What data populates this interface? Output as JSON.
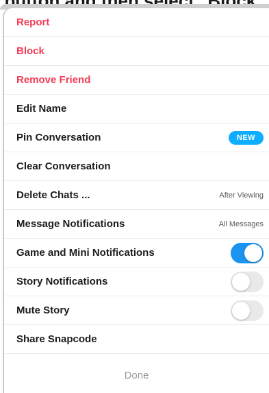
{
  "top_caption": "button and then select \"Block\"",
  "menu": {
    "items": [
      {
        "label": "Report",
        "style": "danger",
        "trailing": "none"
      },
      {
        "label": "Block",
        "style": "danger",
        "trailing": "none"
      },
      {
        "label": "Remove Friend",
        "style": "danger",
        "trailing": "none"
      },
      {
        "label": "Edit Name",
        "style": "normal",
        "trailing": "none"
      },
      {
        "label": "Pin Conversation",
        "style": "normal",
        "trailing": "badge",
        "badge": "NEW"
      },
      {
        "label": "Clear Conversation",
        "style": "normal",
        "trailing": "none"
      },
      {
        "label": "Delete Chats ...",
        "style": "normal",
        "trailing": "value",
        "value": "After Viewing"
      },
      {
        "label": "Message Notifications",
        "style": "normal",
        "trailing": "value",
        "value": "All Messages"
      },
      {
        "label": "Game and Mini Notifications",
        "style": "normal",
        "trailing": "toggle",
        "toggle_on": true
      },
      {
        "label": "Story Notifications",
        "style": "normal",
        "trailing": "toggle",
        "toggle_on": false
      },
      {
        "label": "Mute Story",
        "style": "normal",
        "trailing": "toggle",
        "toggle_on": false
      },
      {
        "label": "Share Snapcode",
        "style": "normal",
        "trailing": "none"
      }
    ]
  },
  "done_label": "Done",
  "colors": {
    "danger": "#f23c57",
    "accent": "#1a94f0",
    "badge": "#0fadff"
  }
}
